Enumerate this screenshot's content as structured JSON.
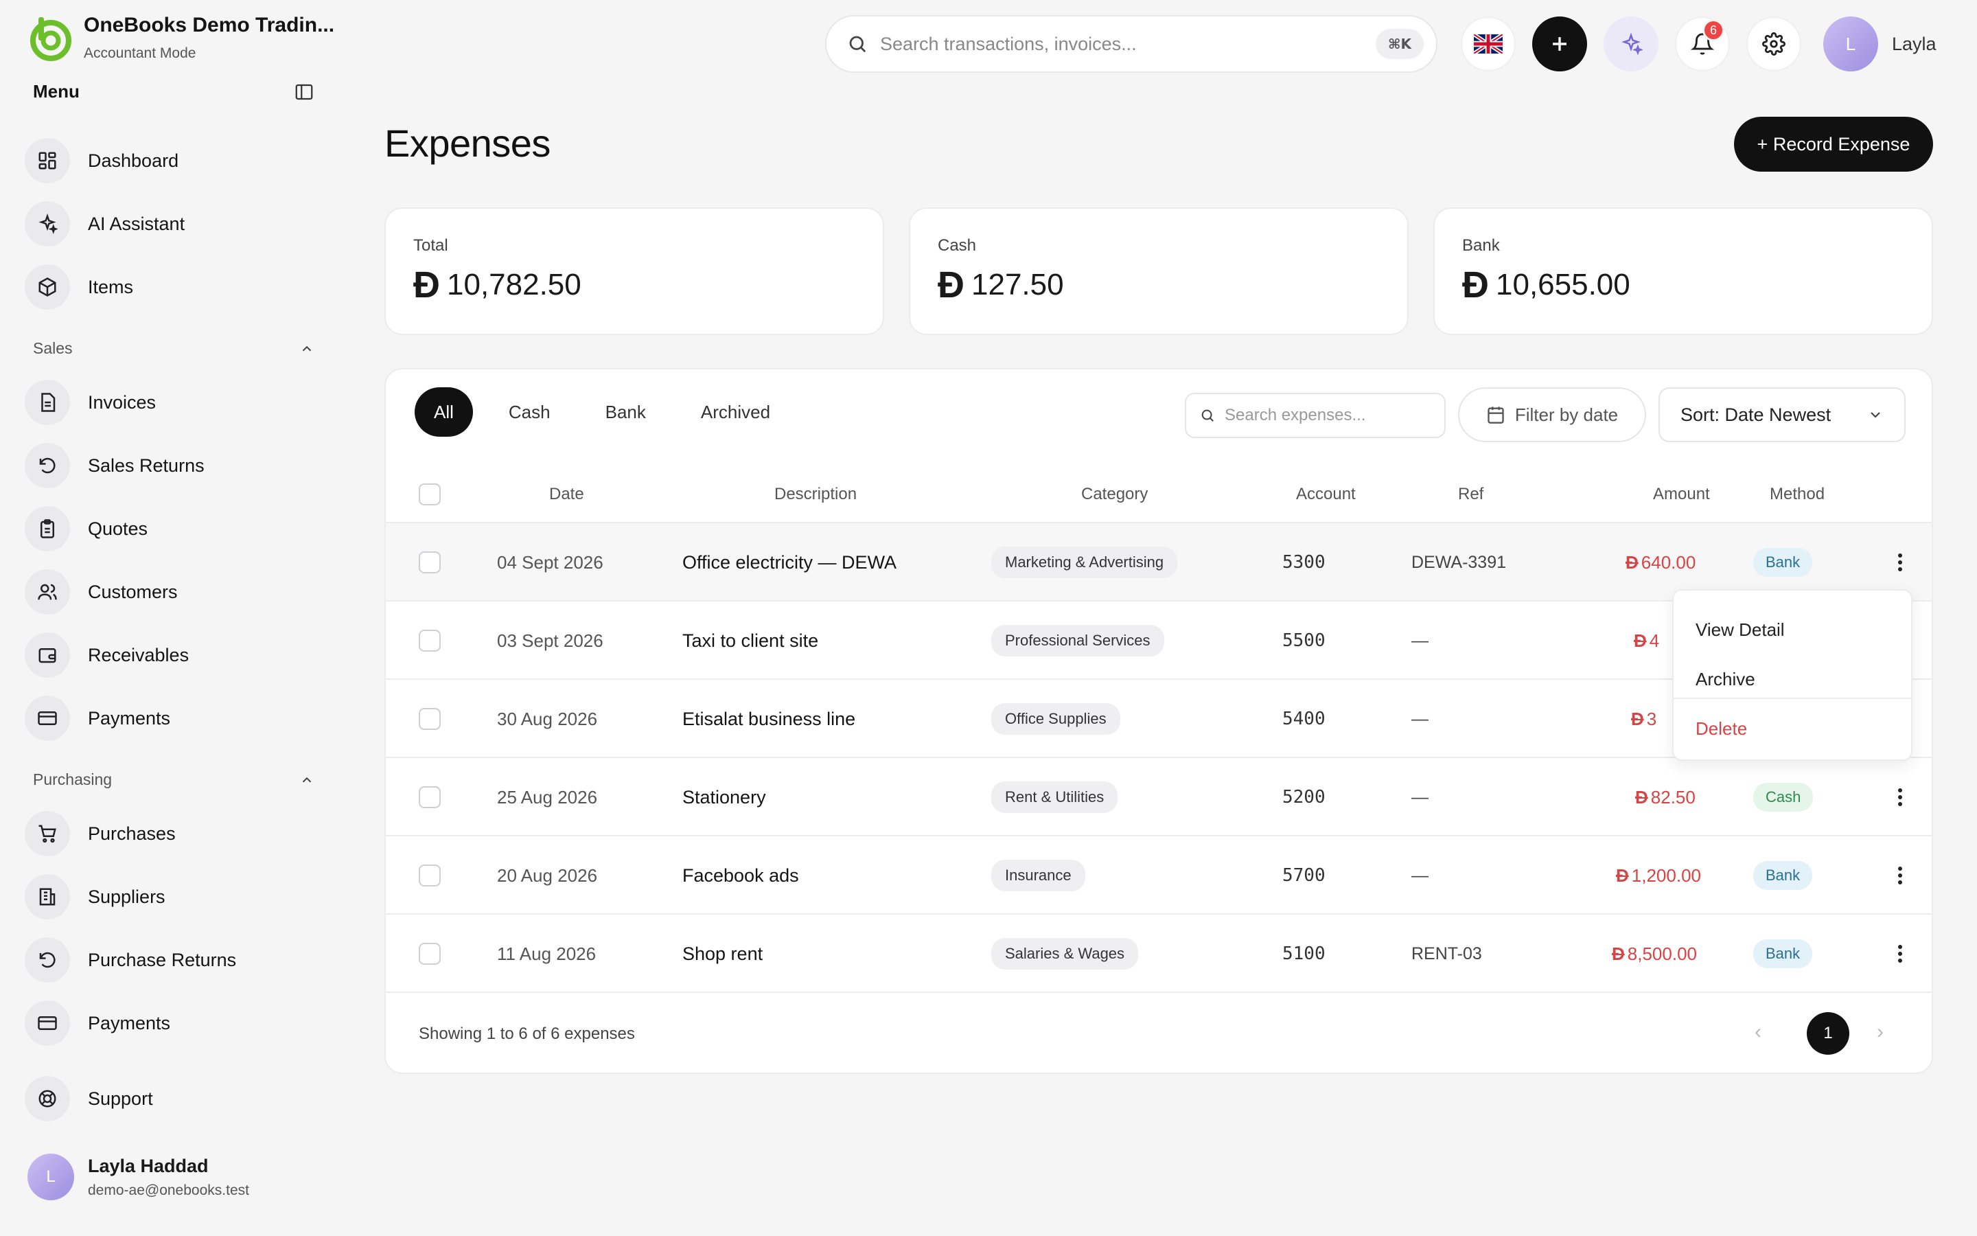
{
  "brand": {
    "name": "OneBooks Demo Tradin...",
    "mode": "Accountant Mode"
  },
  "sidebar": {
    "menu_label": "Menu",
    "main_items": [
      {
        "label": "Dashboard",
        "icon": "dashboard-icon"
      },
      {
        "label": "AI Assistant",
        "icon": "sparkles-icon"
      },
      {
        "label": "Items",
        "icon": "box-icon"
      }
    ],
    "sales_label": "Sales",
    "sales_items": [
      {
        "label": "Invoices",
        "icon": "document-icon"
      },
      {
        "label": "Sales Returns",
        "icon": "return-icon"
      },
      {
        "label": "Quotes",
        "icon": "clipboard-icon"
      },
      {
        "label": "Customers",
        "icon": "users-icon"
      },
      {
        "label": "Receivables",
        "icon": "wallet-icon"
      },
      {
        "label": "Payments",
        "icon": "card-icon"
      }
    ],
    "purchasing_label": "Purchasing",
    "purchasing_items": [
      {
        "label": "Purchases",
        "icon": "cart-icon"
      },
      {
        "label": "Suppliers",
        "icon": "building-icon"
      },
      {
        "label": "Purchase Returns",
        "icon": "return-icon"
      },
      {
        "label": "Payments",
        "icon": "card-icon"
      }
    ],
    "support_label": "Support",
    "user": {
      "initial": "L",
      "name": "Layla Haddad",
      "email": "demo-ae@onebooks.test"
    }
  },
  "topbar": {
    "search_placeholder": "Search transactions, invoices...",
    "shortcut": "⌘K",
    "notifications_count": "6",
    "user_initial": "L",
    "user_name": "Layla"
  },
  "page": {
    "title": "Expenses",
    "record_button": "+ Record Expense"
  },
  "currency_symbol": "Đ",
  "stats": [
    {
      "label": "Total",
      "value": "10,782.50"
    },
    {
      "label": "Cash",
      "value": "127.50"
    },
    {
      "label": "Bank",
      "value": "10,655.00"
    }
  ],
  "tabs": [
    "All",
    "Cash",
    "Bank",
    "Archived"
  ],
  "table_controls": {
    "search_placeholder": "Search expenses...",
    "filter_label": "Filter by date",
    "sort_label": "Sort: Date Newest"
  },
  "columns": [
    "Date",
    "Description",
    "Category",
    "Account",
    "Ref",
    "Amount",
    "Method"
  ],
  "rows": [
    {
      "date": "04 Sept 2026",
      "description": "Office electricity — DEWA",
      "category": "Marketing & Advertising",
      "account": "5300",
      "ref": "DEWA-3391",
      "amount": "640.00",
      "method": "Bank"
    },
    {
      "date": "03 Sept 2026",
      "description": "Taxi to client site",
      "category": "Professional Services",
      "account": "5500",
      "ref": "—",
      "amount": "4",
      "method": ""
    },
    {
      "date": "30 Aug 2026",
      "description": "Etisalat business line",
      "category": "Office Supplies",
      "account": "5400",
      "ref": "—",
      "amount": "3",
      "method": ""
    },
    {
      "date": "25 Aug 2026",
      "description": "Stationery",
      "category": "Rent & Utilities",
      "account": "5200",
      "ref": "—",
      "amount": "82.50",
      "method": "Cash"
    },
    {
      "date": "20 Aug 2026",
      "description": "Facebook ads",
      "category": "Insurance",
      "account": "5700",
      "ref": "—",
      "amount": "1,200.00",
      "method": "Bank"
    },
    {
      "date": "11 Aug 2026",
      "description": "Shop rent",
      "category": "Salaries & Wages",
      "account": "5100",
      "ref": "RENT-03",
      "amount": "8,500.00",
      "method": "Bank"
    }
  ],
  "footer": {
    "showing": "Showing 1 to 6 of 6 expenses",
    "page": "1"
  },
  "row_menu": {
    "view": "View Detail",
    "archive": "Archive",
    "delete": "Delete"
  },
  "colors": {
    "accent": "#6cbf2a",
    "danger": "#d64545",
    "bank_pill": "#e3f1f8",
    "cash_pill": "#e5f5ea"
  }
}
